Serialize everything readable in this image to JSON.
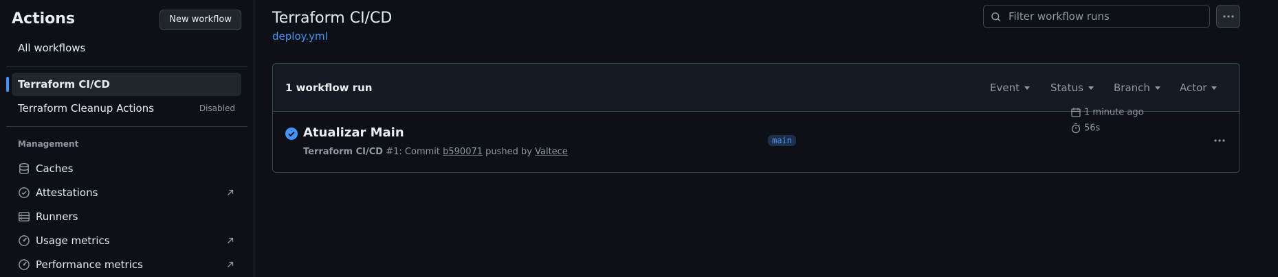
{
  "sidebar": {
    "title": "Actions",
    "new_workflow_label": "New workflow",
    "all_workflows": "All workflows",
    "workflows": [
      {
        "label": "Terraform CI/CD",
        "active": true
      },
      {
        "label": "Terraform Cleanup Actions",
        "badge": "Disabled"
      }
    ],
    "management_heading": "Management",
    "management": [
      {
        "label": "Caches",
        "icon": "database-icon",
        "external": false
      },
      {
        "label": "Attestations",
        "icon": "verified-icon",
        "external": true
      },
      {
        "label": "Runners",
        "icon": "server-icon",
        "external": false
      },
      {
        "label": "Usage metrics",
        "icon": "meter-icon",
        "external": true
      },
      {
        "label": "Performance metrics",
        "icon": "meter-icon",
        "external": true
      }
    ]
  },
  "main": {
    "title": "Terraform CI/CD",
    "file": "deploy.yml",
    "filter_placeholder": "Filter workflow runs",
    "runs_count": "1 workflow run",
    "filters": [
      "Event",
      "Status",
      "Branch",
      "Actor"
    ],
    "runs": [
      {
        "title": "Atualizar Main",
        "workflow": "Terraform CI/CD",
        "run_number": "#1",
        "meta_prefix": ": Commit ",
        "commit": "b590071",
        "pushed_by": " pushed by ",
        "actor": "Valtece",
        "branch": "main",
        "time_ago": "1 minute ago",
        "duration": "56s",
        "status": "success"
      }
    ]
  },
  "colors": {
    "background": "#0d1117",
    "accent": "#4493f8",
    "border": "#3d444d",
    "muted": "#9198a1"
  }
}
